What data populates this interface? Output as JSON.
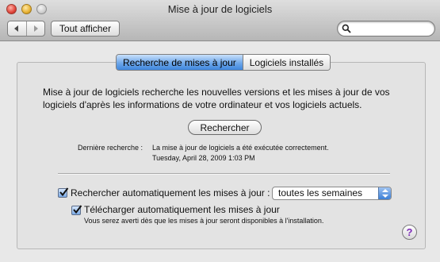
{
  "window": {
    "title": "Mise à jour de logiciels"
  },
  "toolbar": {
    "back_icon": "back-arrow-icon",
    "forward_icon": "forward-arrow-icon",
    "show_all_label": "Tout afficher",
    "search_placeholder": "",
    "search_icon": "search-icon"
  },
  "tabs": [
    {
      "label": "Recherche de mises à jour",
      "active": true
    },
    {
      "label": "Logiciels installés",
      "active": false
    }
  ],
  "main": {
    "intro_text": "Mise à jour de logiciels recherche les nouvelles versions et les mises à jour de vos logiciels d'après les informations de votre ordinateur et vos logiciels actuels.",
    "check_button": "Rechercher",
    "last_check_label": "Dernière recherche :",
    "last_check_message": "La mise à jour de logiciels a été exécutée correctement.",
    "last_check_date": "Tuesday, April 28, 2009 1:03 PM",
    "auto_check": {
      "label": "Rechercher automatiquement les mises à jour :",
      "checked": true
    },
    "frequency": {
      "selected": "toutes les semaines"
    },
    "auto_download": {
      "label": "Télécharger automatiquement les mises à jour",
      "checked": true,
      "note": "Vous serez averti dès que les mises à jour seront disponibles à l'installation."
    },
    "help_glyph": "?"
  },
  "colors": {
    "accent": "#3f86de",
    "window_bg": "#e8e8e8",
    "help_glyph": "#7d2bb8"
  }
}
